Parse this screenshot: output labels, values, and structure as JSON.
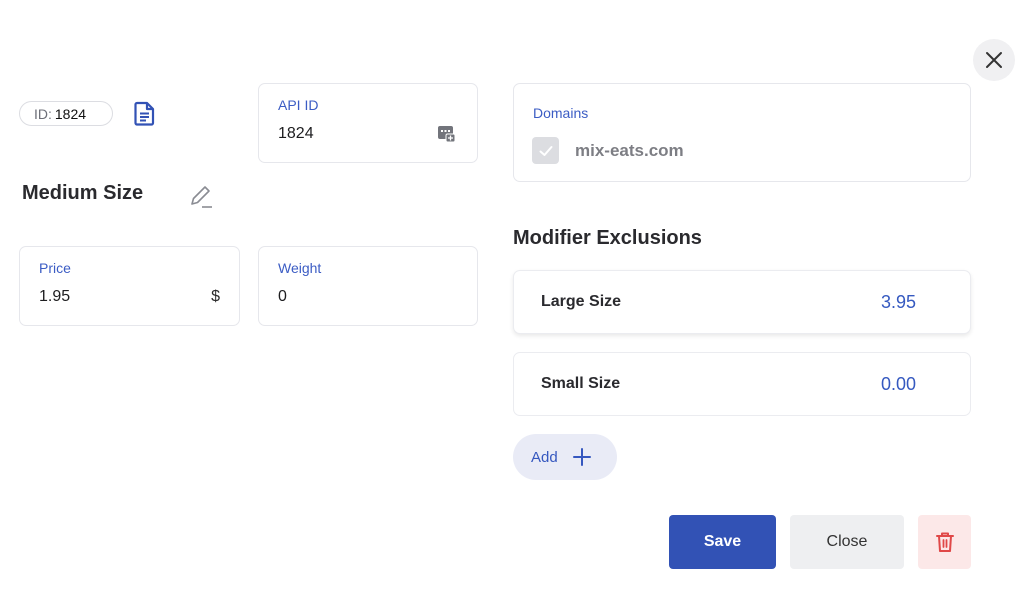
{
  "id_badge": {
    "label": "ID:",
    "value": "1824"
  },
  "item": {
    "name": "Medium Size"
  },
  "api_id": {
    "label": "API ID",
    "value": "1824"
  },
  "price": {
    "label": "Price",
    "value": "1.95",
    "currency": "$"
  },
  "weight": {
    "label": "Weight",
    "value": "0"
  },
  "domains": {
    "label": "Domains",
    "items": [
      {
        "name": "mix-eats.com",
        "checked": true
      }
    ]
  },
  "modifier_exclusions": {
    "title": "Modifier Exclusions",
    "items": [
      {
        "name": "Large Size",
        "price": "3.95"
      },
      {
        "name": "Small Size",
        "price": "0.00"
      }
    ],
    "add_label": "Add"
  },
  "actions": {
    "save": "Save",
    "close": "Close"
  },
  "icons": {
    "close": "close-icon",
    "document": "document-icon",
    "edit": "pencil-icon",
    "api": "api-id-icon",
    "check": "check-icon",
    "add": "plus-icon",
    "delete": "trash-icon"
  },
  "colors": {
    "accent": "#3252b5",
    "link": "#3b5cc4",
    "danger": "#e04848",
    "danger_bg": "#fce8e8"
  }
}
